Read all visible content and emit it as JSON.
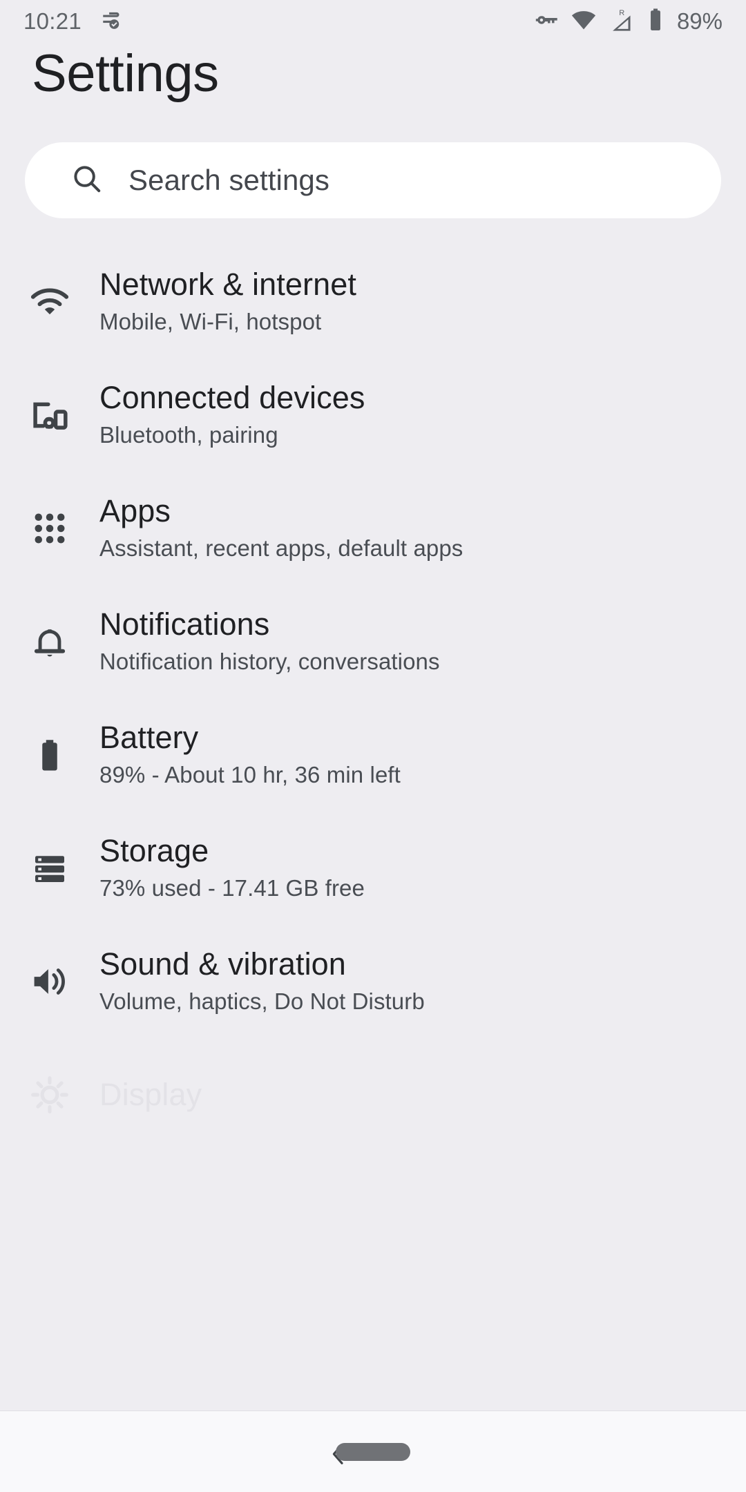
{
  "status_bar": {
    "time": "10:21",
    "left_icons": [
      {
        "name": "data-saver-check-icon",
        "glyph": "data-saver"
      }
    ],
    "right_icons": [
      {
        "name": "vpn-key-icon"
      },
      {
        "name": "wifi-icon"
      },
      {
        "name": "mobile-signal-roaming-icon",
        "badge": "R"
      },
      {
        "name": "battery-icon"
      }
    ],
    "battery_percent": "89%"
  },
  "header": {
    "title": "Settings"
  },
  "search": {
    "placeholder": "Search settings",
    "icon": "search-icon"
  },
  "list": {
    "items": [
      {
        "key": "network-internet",
        "icon": "wifi-icon",
        "title": "Network & internet",
        "subtitle": "Mobile, Wi-Fi, hotspot"
      },
      {
        "key": "connected-devices",
        "icon": "connected-devices-icon",
        "title": "Connected devices",
        "subtitle": "Bluetooth, pairing"
      },
      {
        "key": "apps",
        "icon": "apps-grid-icon",
        "title": "Apps",
        "subtitle": "Assistant, recent apps, default apps"
      },
      {
        "key": "notifications",
        "icon": "bell-icon",
        "title": "Notifications",
        "subtitle": "Notification history, conversations"
      },
      {
        "key": "battery",
        "icon": "battery-icon",
        "title": "Battery",
        "subtitle": "89% - About 10 hr, 36 min left"
      },
      {
        "key": "storage",
        "icon": "storage-icon",
        "title": "Storage",
        "subtitle": "73% used - 17.41 GB free"
      },
      {
        "key": "sound-vibration",
        "icon": "volume-up-icon",
        "title": "Sound & vibration",
        "subtitle": "Volume, haptics, Do Not Disturb"
      },
      {
        "key": "display",
        "icon": "brightness-icon",
        "title": "Display",
        "subtitle": ""
      }
    ]
  },
  "nav_bar": {
    "back": "back-chevron-icon",
    "home": "home-pill-handle"
  },
  "colors": {
    "background": "#eeedf1",
    "surface": "#ffffff",
    "title_text": "#1f2023",
    "secondary_text": "#494d53",
    "status_icon": "#5f6368",
    "list_icon": "#3f4347",
    "nav_pill": "#707276"
  }
}
